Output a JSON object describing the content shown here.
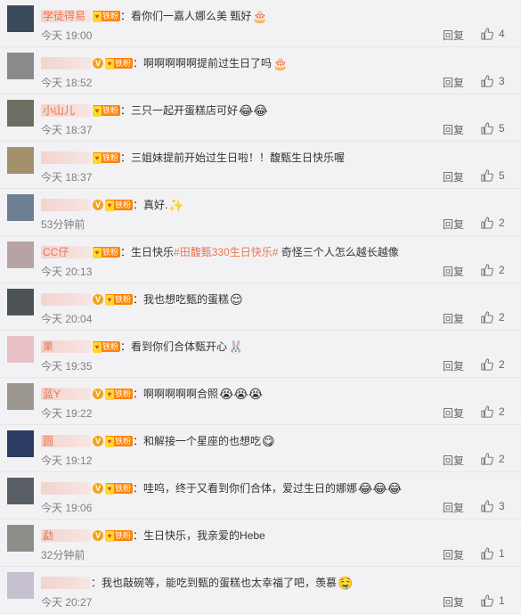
{
  "comments": [
    {
      "username": "学徒得易",
      "verified": false,
      "badge": "铁粉",
      "text": "看你们一嘉人娜么美 甄好",
      "emoji": "🎂",
      "time": "今天 19:00",
      "reply": "回复",
      "likes": "4"
    },
    {
      "username": "",
      "verified": true,
      "badge": "铁粉",
      "text": "啊啊啊啊啊提前过生日了吗",
      "emoji": "🎂",
      "time": "今天 18:52",
      "reply": "回复",
      "likes": "3"
    },
    {
      "username": "小山儿",
      "verified": false,
      "badge": "铁粉",
      "text": "三只一起开蛋糕店可好",
      "emoji": "😂😂",
      "time": "今天 18:37",
      "reply": "回复",
      "likes": "5"
    },
    {
      "username": "",
      "verified": false,
      "badge": "铁粉",
      "text": "三姐妹提前开始过生日啦！！馥甄生日快乐喔",
      "emoji": "",
      "time": "今天 18:37",
      "reply": "回复",
      "likes": "5"
    },
    {
      "username": "",
      "verified": true,
      "badge": "铁粉",
      "text": "真好.",
      "emoji": "✨",
      "time": "53分钟前",
      "reply": "回复",
      "likes": "2"
    },
    {
      "username": "CC仔",
      "verified": false,
      "badge": "铁粉",
      "text_before": "生日快乐",
      "tag": "#田馥甄330生日快乐#",
      "text_after": " 奇怪三个人怎么越长越像",
      "time": "今天 20:13",
      "reply": "回复",
      "likes": "2"
    },
    {
      "username": "",
      "verified": true,
      "badge": "铁粉",
      "text": "我也想吃甄的蛋糕",
      "emoji": "😌",
      "time": "今天 20:04",
      "reply": "回复",
      "likes": "2"
    },
    {
      "username": "果",
      "verified": false,
      "badge": "铁粉",
      "text": "看到你们合体甄开心",
      "emoji": "🐰",
      "time": "今天 19:35",
      "reply": "回复",
      "likes": "2"
    },
    {
      "username": "蓝Y",
      "verified": true,
      "badge": "铁粉",
      "text": "啊啊啊啊啊合照",
      "emoji": "😭😭😭",
      "time": "今天 19:22",
      "reply": "回复",
      "likes": "2"
    },
    {
      "username": "圆",
      "verified": true,
      "badge": "铁粉",
      "text": "和解接一个星座的也想吃",
      "emoji": "😋",
      "time": "今天 19:12",
      "reply": "回复",
      "likes": "2"
    },
    {
      "username": "",
      "verified": true,
      "badge": "铁粉",
      "text": "哇呜，终于又看到你们合体，爱过生日的娜娜",
      "emoji": "😂😂😂",
      "time": "今天 19:06",
      "reply": "回复",
      "likes": "3"
    },
    {
      "username": "勐",
      "verified": true,
      "badge": "铁粉",
      "text": "生日快乐，我亲爱的Hebe",
      "emoji": "",
      "time": "32分钟前",
      "reply": "回复",
      "likes": "1"
    },
    {
      "username": "",
      "verified": false,
      "badge": "",
      "text": "我也敲碗等，能吃到甄的蛋糕也太幸福了吧，羡慕",
      "emoji": "🤤",
      "time": "今天 20:27",
      "reply": "回复",
      "likes": "1"
    }
  ]
}
